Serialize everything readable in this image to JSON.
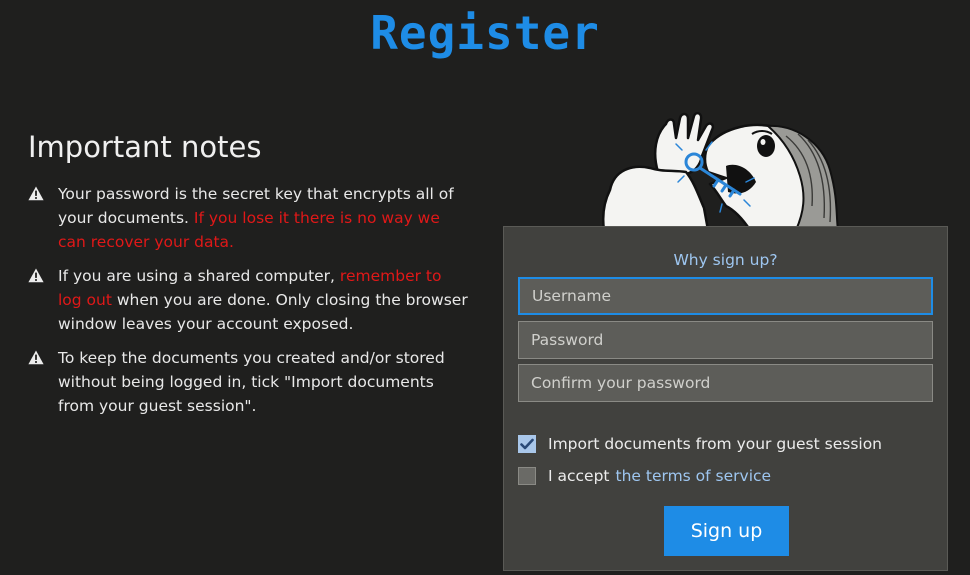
{
  "colors": {
    "accent": "#1e8ce6",
    "danger": "#e01818",
    "link": "#9ec6f0",
    "background": "#1f1f1e",
    "panel": "#41413e"
  },
  "page": {
    "title": "Register"
  },
  "notes": {
    "heading": "Important notes",
    "items": [
      {
        "icon": "warning-icon",
        "text_before": "Your password is the secret key that encrypts all of your documents. ",
        "highlight": "If you lose it there is no way we can recover your data.",
        "text_after": ""
      },
      {
        "icon": "warning-icon",
        "text_before": "If you are using a shared computer, ",
        "highlight": "remember to log out",
        "text_after": " when you are done. Only closing the browser window leaves your account exposed."
      },
      {
        "icon": "warning-icon",
        "text_before": "To keep the documents you created and/or stored without being logged in, tick \"Import documents from your guest session\".",
        "highlight": "",
        "text_after": ""
      }
    ]
  },
  "form": {
    "why_link": "Why sign up?",
    "username_placeholder": "Username",
    "password_placeholder": "Password",
    "confirm_placeholder": "Confirm your password",
    "import_label": "Import documents from your guest session",
    "import_checked": true,
    "accept_label": "I accept",
    "terms_link": "the terms of service",
    "accept_checked": false,
    "submit_label": "Sign up"
  }
}
